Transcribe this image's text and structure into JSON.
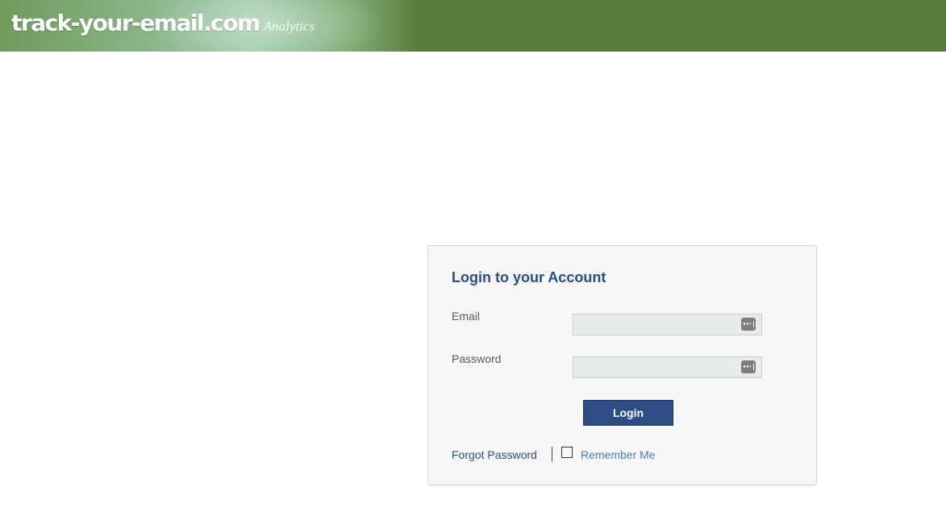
{
  "header": {
    "brand": "track-your-email.com",
    "subtitle": "Analytics",
    "background_color": "#577b3a"
  },
  "login": {
    "title": "Login to your Account",
    "email_label": "Email",
    "email_value": "",
    "password_label": "Password",
    "password_value": "",
    "field_icon": "password-manager-key-icon",
    "button_label": "Login",
    "forgot_label": "Forgot Password",
    "separator": "|",
    "remember_label": "Remember Me",
    "remember_checked": false,
    "accent_color": "#2d4e84",
    "link_color": "#4a7cc2"
  }
}
